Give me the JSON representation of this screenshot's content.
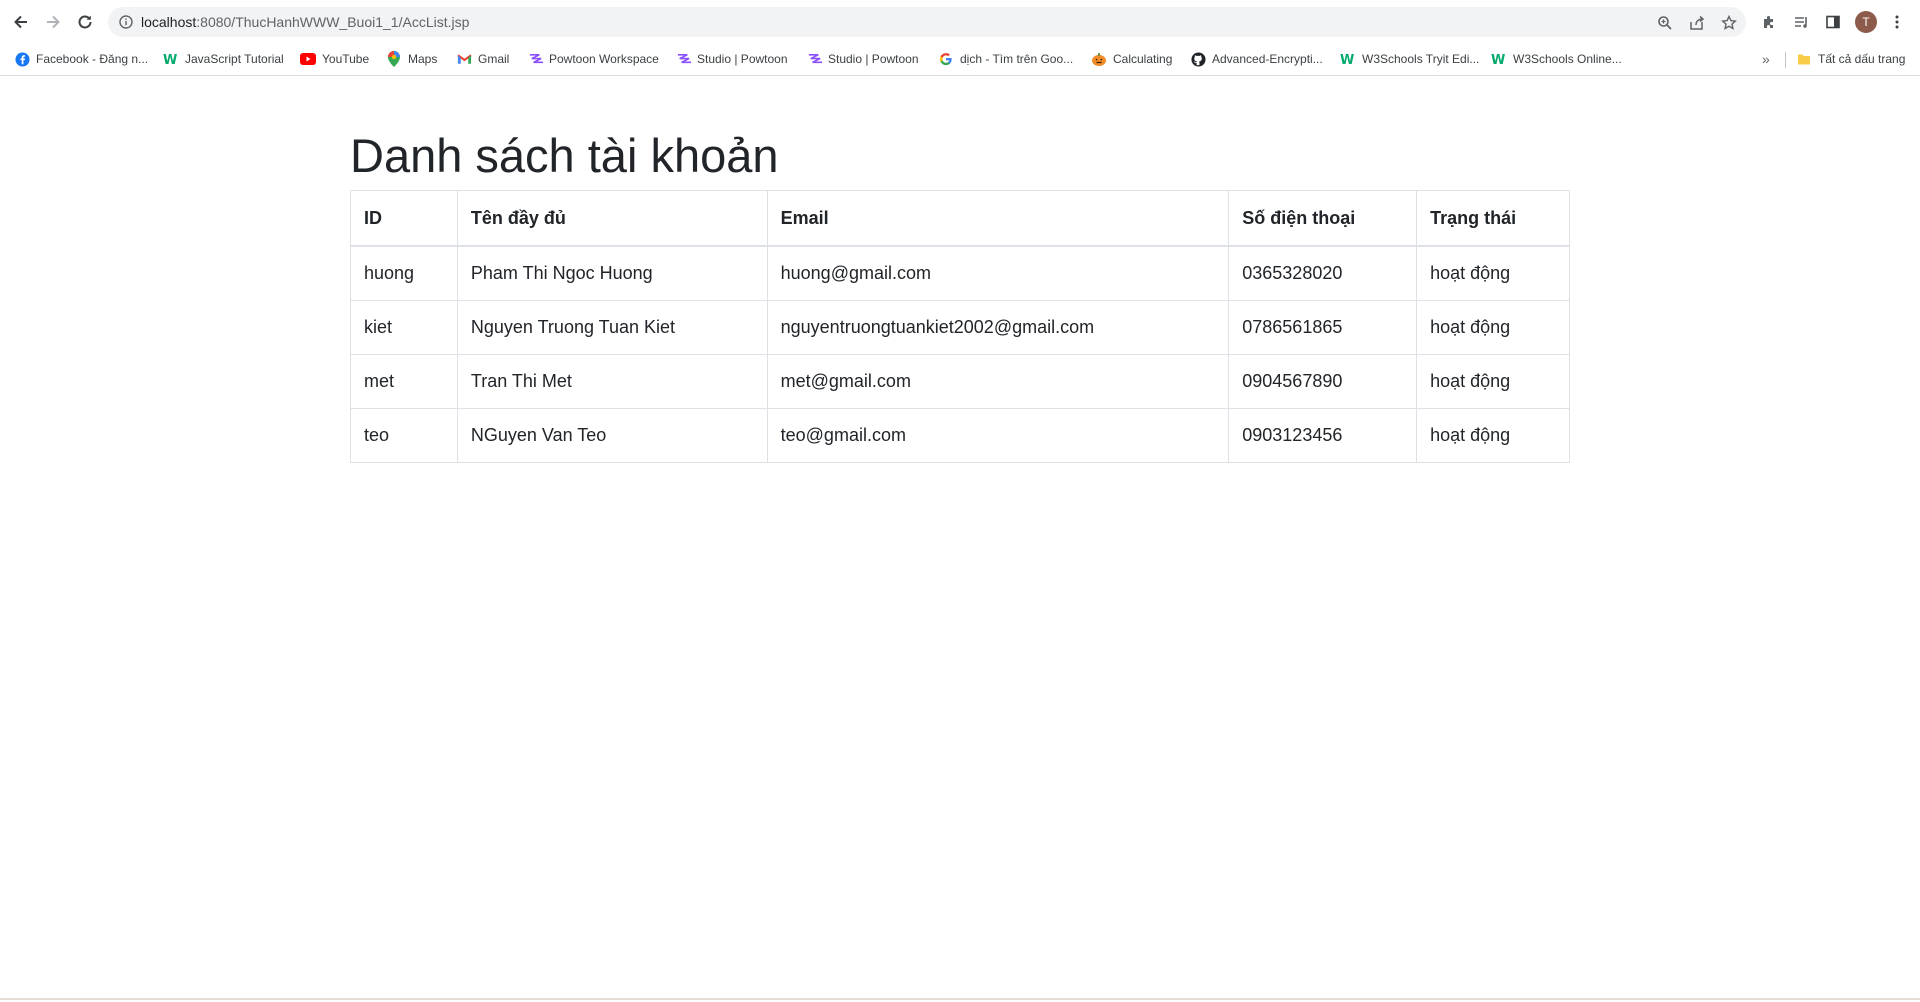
{
  "browser": {
    "url_host": "localhost",
    "url_path": ":8080/ThucHanhWWW_Buoi1_1/AccList.jsp",
    "profile_initial": "T",
    "bookmarks": [
      {
        "label": "Facebook - Đăng n...",
        "icon": "facebook-icon"
      },
      {
        "label": "JavaScript Tutorial",
        "icon": "w3schools-icon"
      },
      {
        "label": "YouTube",
        "icon": "youtube-icon"
      },
      {
        "label": "Maps",
        "icon": "maps-icon"
      },
      {
        "label": "Gmail",
        "icon": "gmail-icon"
      },
      {
        "label": "Powtoon Workspace",
        "icon": "powtoon-icon"
      },
      {
        "label": "Studio | Powtoon",
        "icon": "powtoon-icon"
      },
      {
        "label": "Studio | Powtoon",
        "icon": "powtoon-icon"
      },
      {
        "label": "dịch - Tìm trên Goo...",
        "icon": "google-icon"
      },
      {
        "label": "Calculating",
        "icon": "pumpkin-icon"
      },
      {
        "label": "Advanced-Encrypti...",
        "icon": "github-icon"
      },
      {
        "label": "W3Schools Tryit Edi...",
        "icon": "w3schools-icon"
      },
      {
        "label": "W3Schools Online...",
        "icon": "w3schools-icon"
      }
    ],
    "all_bookmarks_label": "Tất cả dấu trang"
  },
  "page": {
    "title": "Danh sách tài khoản",
    "table": {
      "headers": [
        "ID",
        "Tên đầy đủ",
        "Email",
        "Số điện thoại",
        "Trạng thái"
      ],
      "rows": [
        [
          "huong",
          "Pham Thi Ngoc Huong",
          "huong@gmail.com",
          "0365328020",
          "hoạt động"
        ],
        [
          "kiet",
          "Nguyen Truong Tuan Kiet",
          "nguyentruongtuankiet2002@gmail.com",
          "0786561865",
          "hoạt động"
        ],
        [
          "met",
          "Tran Thi Met",
          "met@gmail.com",
          "0904567890",
          "hoạt động"
        ],
        [
          "teo",
          "NGuyen Van Teo",
          "teo@gmail.com",
          "0903123456",
          "hoạt động"
        ]
      ]
    }
  },
  "colors": {
    "text": "#212529",
    "border": "#dee2e6",
    "chrome_bg": "#f1f3f4"
  }
}
